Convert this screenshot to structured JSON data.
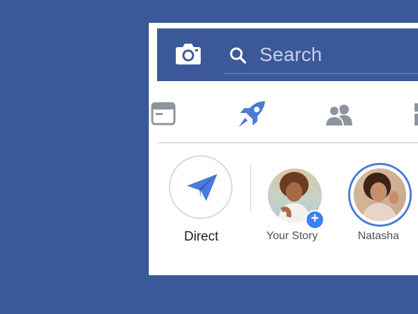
{
  "colors": {
    "background": "#3b5998",
    "accent": "#4b7bd4",
    "icon_gray": "#8d949e"
  },
  "header": {
    "camera_icon": "camera-icon",
    "search_placeholder": "Search",
    "search_icon": "search-icon"
  },
  "tabs": [
    {
      "name": "feed",
      "icon": "news-feed-icon",
      "active": false
    },
    {
      "name": "stories",
      "icon": "rocket-icon",
      "active": true
    },
    {
      "name": "friends",
      "icon": "friends-icon",
      "active": false
    },
    {
      "name": "marketplace",
      "icon": "store-icon",
      "active": false
    }
  ],
  "stories": {
    "direct_label": "Direct",
    "your_story_label": "Your Story",
    "friend_label": "Natasha"
  }
}
